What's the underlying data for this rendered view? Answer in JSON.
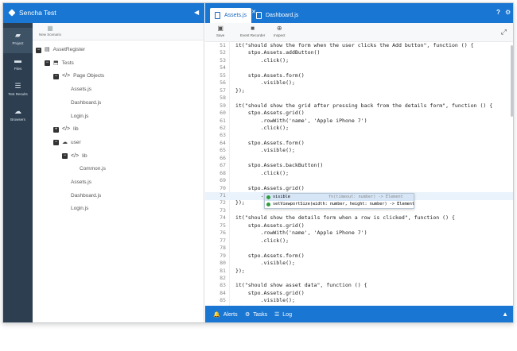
{
  "app": {
    "title": "Sencha Test",
    "collapse_icon": "chevron-left-icon"
  },
  "nav": [
    {
      "label": "Project",
      "icon": "briefcase-icon",
      "active": true
    },
    {
      "label": "Files",
      "icon": "folder-icon",
      "active": false
    },
    {
      "label": "Test Results",
      "icon": "list-icon",
      "active": false
    },
    {
      "label": "Browsers",
      "icon": "cloud-icon",
      "active": false
    }
  ],
  "tree": {
    "new_scenario": "New Scenario",
    "rows": [
      {
        "toggle": "−",
        "icon": "▤",
        "label": "AssetRegister"
      },
      {
        "toggle": "−",
        "icon": "⬒",
        "label": "Tests"
      },
      {
        "toggle": "−",
        "icon": "</>",
        "label": "Page Objects"
      },
      {
        "toggle": "",
        "icon": "",
        "label": "Assets.js"
      },
      {
        "toggle": "",
        "icon": "",
        "label": "Dashboard.js"
      },
      {
        "toggle": "",
        "icon": "",
        "label": "Login.js"
      },
      {
        "toggle": "+",
        "icon": "</>",
        "label": "lib"
      },
      {
        "toggle": "−",
        "icon": "☁",
        "label": "user"
      },
      {
        "toggle": "−",
        "icon": "</>",
        "label": "lib"
      },
      {
        "toggle": "",
        "icon": "",
        "label": "Common.js"
      },
      {
        "toggle": "",
        "icon": "",
        "label": "Assets.js"
      },
      {
        "toggle": "",
        "icon": "",
        "label": "Dashboard.js"
      },
      {
        "toggle": "",
        "icon": "",
        "label": "Login.js"
      }
    ]
  },
  "tabs": [
    {
      "label": "Assets.js",
      "active": true
    },
    {
      "label": "Dashboard.js",
      "active": false
    }
  ],
  "toolbar": {
    "save": "Save",
    "recorder": "Event Recorder",
    "inspect": "Inspect"
  },
  "code": [
    {
      "n": "51",
      "t": "it(\"should show the form when the user clicks the Add button\", function () {"
    },
    {
      "n": "52",
      "t": "    stpo.Assets.addButton()"
    },
    {
      "n": "53",
      "t": "        .click();"
    },
    {
      "n": "54",
      "t": ""
    },
    {
      "n": "55",
      "t": "    stpo.Assets.form()"
    },
    {
      "n": "56",
      "t": "        .visible();"
    },
    {
      "n": "57",
      "t": "});"
    },
    {
      "n": "58",
      "t": ""
    },
    {
      "n": "59",
      "t": "it(\"should show the grid after pressing back from the details form\", function () {"
    },
    {
      "n": "60",
      "t": "    stpo.Assets.grid()"
    },
    {
      "n": "61",
      "t": "        .rowWith('name', 'Apple iPhone 7')"
    },
    {
      "n": "62",
      "t": "        .click();"
    },
    {
      "n": "63",
      "t": ""
    },
    {
      "n": "64",
      "t": "    stpo.Assets.form()"
    },
    {
      "n": "65",
      "t": "        .visible();"
    },
    {
      "n": "66",
      "t": ""
    },
    {
      "n": "67",
      "t": "    stpo.Assets.backButton()"
    },
    {
      "n": "68",
      "t": "        .click();"
    },
    {
      "n": "69",
      "t": ""
    },
    {
      "n": "70",
      "t": "    stpo.Assets.grid()"
    },
    {
      "n": "71",
      "t": "        .vis"
    },
    {
      "n": "72",
      "t": "});"
    },
    {
      "n": "73",
      "t": ""
    },
    {
      "n": "74",
      "t": "it(\"should show the details form when a row is clicked\", function () {"
    },
    {
      "n": "75",
      "t": "    stpo.Assets.grid()"
    },
    {
      "n": "76",
      "t": "        .rowWith('name', 'Apple iPhone 7')"
    },
    {
      "n": "77",
      "t": "        .click();"
    },
    {
      "n": "78",
      "t": ""
    },
    {
      "n": "79",
      "t": "    stpo.Assets.form()"
    },
    {
      "n": "80",
      "t": "        .visible();"
    },
    {
      "n": "81",
      "t": "});"
    },
    {
      "n": "82",
      "t": ""
    },
    {
      "n": "83",
      "t": "it(\"should show asset data\", function () {"
    },
    {
      "n": "84",
      "t": "    stpo.Assets.grid()"
    },
    {
      "n": "85",
      "t": "        .visible();"
    }
  ],
  "current_line": "71",
  "autocomplete": [
    {
      "name": "visible",
      "sig": "fn(timeout: number) -> Element"
    },
    {
      "name": "setViewportSize(width: number, height: number) -> Element",
      "sig": ""
    }
  ],
  "statusbar": {
    "alerts": "Alerts",
    "tasks": "Tasks",
    "log": "Log"
  },
  "colors": {
    "primary": "#1976d2",
    "nav": "#2c3e50"
  }
}
